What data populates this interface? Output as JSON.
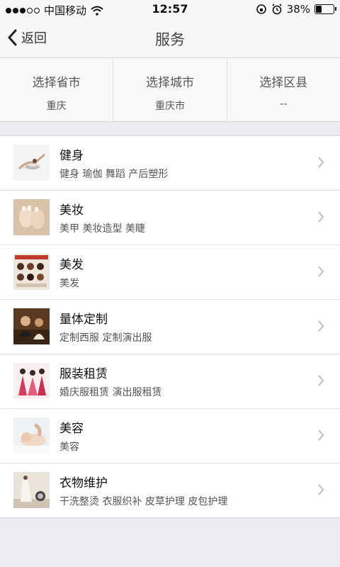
{
  "status_bar": {
    "carrier": "中国移动",
    "time": "12:57",
    "battery": "38%",
    "battery_level": 0.38,
    "icons": [
      "signal-dots",
      "wifi-icon",
      "rotation-lock-icon",
      "alarm-icon",
      "battery-icon"
    ]
  },
  "nav": {
    "back_label": "返回",
    "title": "服务"
  },
  "region": {
    "province": {
      "title": "选择省市",
      "value": "重庆"
    },
    "city": {
      "title": "选择城市",
      "value": "重庆市"
    },
    "district": {
      "title": "选择区县",
      "value": "--"
    }
  },
  "services": [
    {
      "title": "健身",
      "subtitle": "健身 瑜伽 舞蹈 产后塑形"
    },
    {
      "title": "美妆",
      "subtitle": "美甲 美妆造型 美睫"
    },
    {
      "title": "美发",
      "subtitle": "美发"
    },
    {
      "title": "量体定制",
      "subtitle": "定制西服 定制演出服"
    },
    {
      "title": "服装租赁",
      "subtitle": "婚庆服租赁 演出服租赁"
    },
    {
      "title": "美容",
      "subtitle": "美容"
    },
    {
      "title": "衣物维护",
      "subtitle": "干洗整烫 衣服织补 皮草护理 皮包护理"
    }
  ]
}
